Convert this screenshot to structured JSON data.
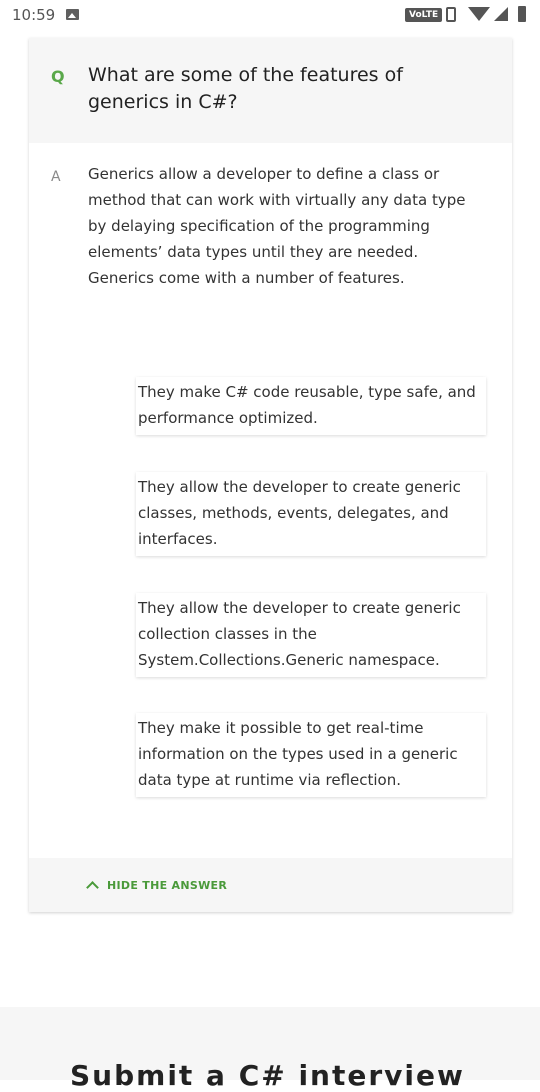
{
  "status_bar": {
    "time": "10:59",
    "network_badge": "VoLTE"
  },
  "qa": {
    "question_marker": "Q",
    "question": "What are some of the features of generics in C#?",
    "answer_marker": "A",
    "answer": "Generics allow a developer to define a class or method that can work with virtually any data type by delaying specification of the programming elements’ data types until they are needed. Generics come with a number of features.",
    "features": [
      "They make C# code reusable, type safe, and performance optimized.",
      "They allow the developer to create generic classes, methods, events, delegates, and interfaces.",
      "They allow the developer to create generic collection classes in the System.Collections.Generic namespace.",
      "They make it possible to get real-time information on the types used in a generic data type at runtime via reflection."
    ],
    "hide_answer_label": "HIDE THE ANSWER"
  },
  "bottom": {
    "title": "Submit a C# interview"
  },
  "colors": {
    "accent_green": "#5aa84a",
    "panel_grey": "#f6f6f6"
  }
}
